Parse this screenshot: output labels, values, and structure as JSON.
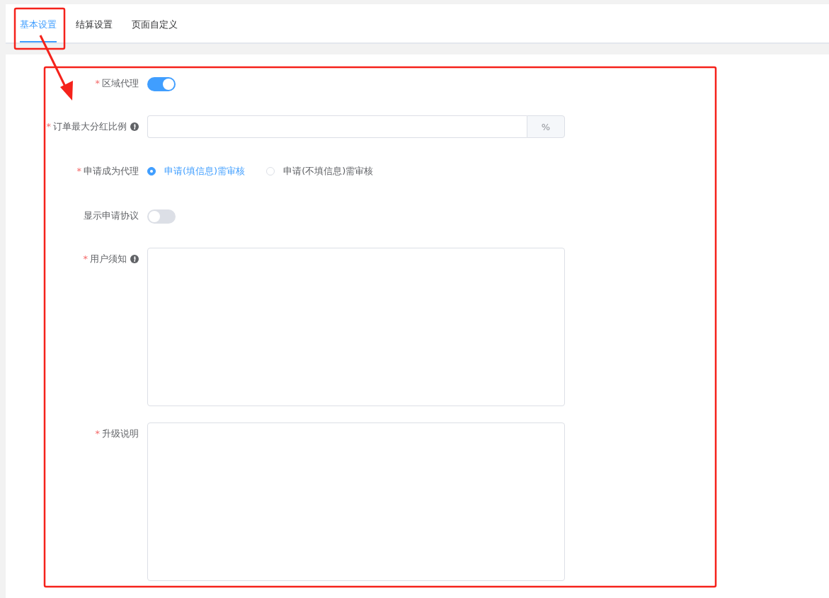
{
  "tabs": [
    {
      "label": "基本设置",
      "selected": true
    },
    {
      "label": "结算设置",
      "selected": false
    },
    {
      "label": "页面自定义",
      "selected": false
    }
  ],
  "form": [
    {
      "kind": "switch",
      "required_mark": "*",
      "label": "区域代理",
      "info": false,
      "on": true
    },
    {
      "kind": "input",
      "required_mark": "*",
      "label": "订单最大分红比例",
      "info": true,
      "addon": "%"
    },
    {
      "kind": "radio",
      "required_mark": "*",
      "label": "申请成为代理",
      "info": false,
      "options": [
        {
          "label": "申请(填信息)需审核",
          "selected": true
        },
        {
          "label": "申请(不填信息)需审核",
          "selected": false
        }
      ]
    },
    {
      "kind": "switch",
      "label": "显示申请协议",
      "info": false,
      "on": false
    },
    {
      "kind": "textarea",
      "required_mark": "*",
      "label": "用户须知",
      "info": true
    },
    {
      "kind": "textarea",
      "required_mark": "*",
      "label": "升级说明",
      "info": false
    }
  ]
}
